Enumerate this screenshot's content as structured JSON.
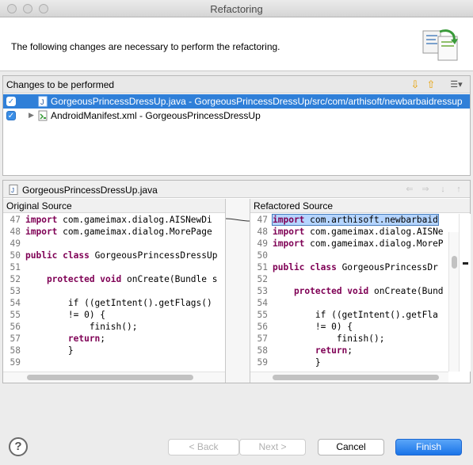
{
  "window": {
    "title": "Refactoring"
  },
  "header": {
    "message": "The following changes are necessary to perform the refactoring."
  },
  "changes": {
    "title": "Changes to be performed",
    "items": [
      {
        "label": "GorgeousPrincessDressUp.java - GorgeousPrincessDressUp/src/com/arthisoft/newbarbaidressup",
        "checked": true,
        "selected": true,
        "icon": "java-file-icon"
      },
      {
        "label": "AndroidManifest.xml - GorgeousPrincessDressUp",
        "checked": true,
        "selected": false,
        "icon": "xml-file-icon"
      }
    ]
  },
  "compare": {
    "file": "GorgeousPrincessDressUp.java",
    "left_title": "Original Source",
    "right_title": "Refactored Source",
    "left_lines": [
      {
        "n": "47",
        "kw": "import",
        "text": " com.gameimax.dialog.AISNewDi"
      },
      {
        "n": "48",
        "kw": "import",
        "text": " com.gameimax.dialog.MorePage"
      },
      {
        "n": "49",
        "kw": "",
        "text": ""
      },
      {
        "n": "50",
        "kw": "public class",
        "text": " GorgeousPrincessDressUp"
      },
      {
        "n": "51",
        "kw": "",
        "text": ""
      },
      {
        "n": "52",
        "kw": "    protected void",
        "text": " onCreate(Bundle s"
      },
      {
        "n": "53",
        "kw": "",
        "text": ""
      },
      {
        "n": "54",
        "kw": "",
        "text": "        if ((getIntent().getFlags()"
      },
      {
        "n": "55",
        "kw": "",
        "text": "        != 0) {"
      },
      {
        "n": "56",
        "kw": "",
        "text": "            finish();"
      },
      {
        "n": "57",
        "kw": "        return",
        "text": ";"
      },
      {
        "n": "58",
        "kw": "",
        "text": "        }"
      },
      {
        "n": "59",
        "kw": "",
        "text": ""
      }
    ],
    "right_lines": [
      {
        "n": "47",
        "kw": "import",
        "text": " com.arthisoft.newbarbaid",
        "hl": true
      },
      {
        "n": "48",
        "kw": "import",
        "text": " com.gameimax.dialog.AISNe"
      },
      {
        "n": "49",
        "kw": "import",
        "text": " com.gameimax.dialog.MoreP"
      },
      {
        "n": "50",
        "kw": "",
        "text": ""
      },
      {
        "n": "51",
        "kw": "public class",
        "text": " GorgeousPrincessDr"
      },
      {
        "n": "52",
        "kw": "",
        "text": ""
      },
      {
        "n": "53",
        "kw": "    protected void",
        "text": " onCreate(Bund"
      },
      {
        "n": "54",
        "kw": "",
        "text": ""
      },
      {
        "n": "55",
        "kw": "",
        "text": "        if ((getIntent().getFla"
      },
      {
        "n": "56",
        "kw": "",
        "text": "        != 0) {"
      },
      {
        "n": "57",
        "kw": "",
        "text": "            finish();"
      },
      {
        "n": "58",
        "kw": "        return",
        "text": ";"
      },
      {
        "n": "59",
        "kw": "",
        "text": "        }"
      }
    ]
  },
  "buttons": {
    "back": "< Back",
    "next": "Next >",
    "cancel": "Cancel",
    "finish": "Finish"
  },
  "icons": {
    "help": "?",
    "check": "✓",
    "expand": "▶"
  },
  "colors": {
    "selection": "#2f7fd8",
    "accent": "#1a74e8",
    "keyword": "#7f0055"
  }
}
